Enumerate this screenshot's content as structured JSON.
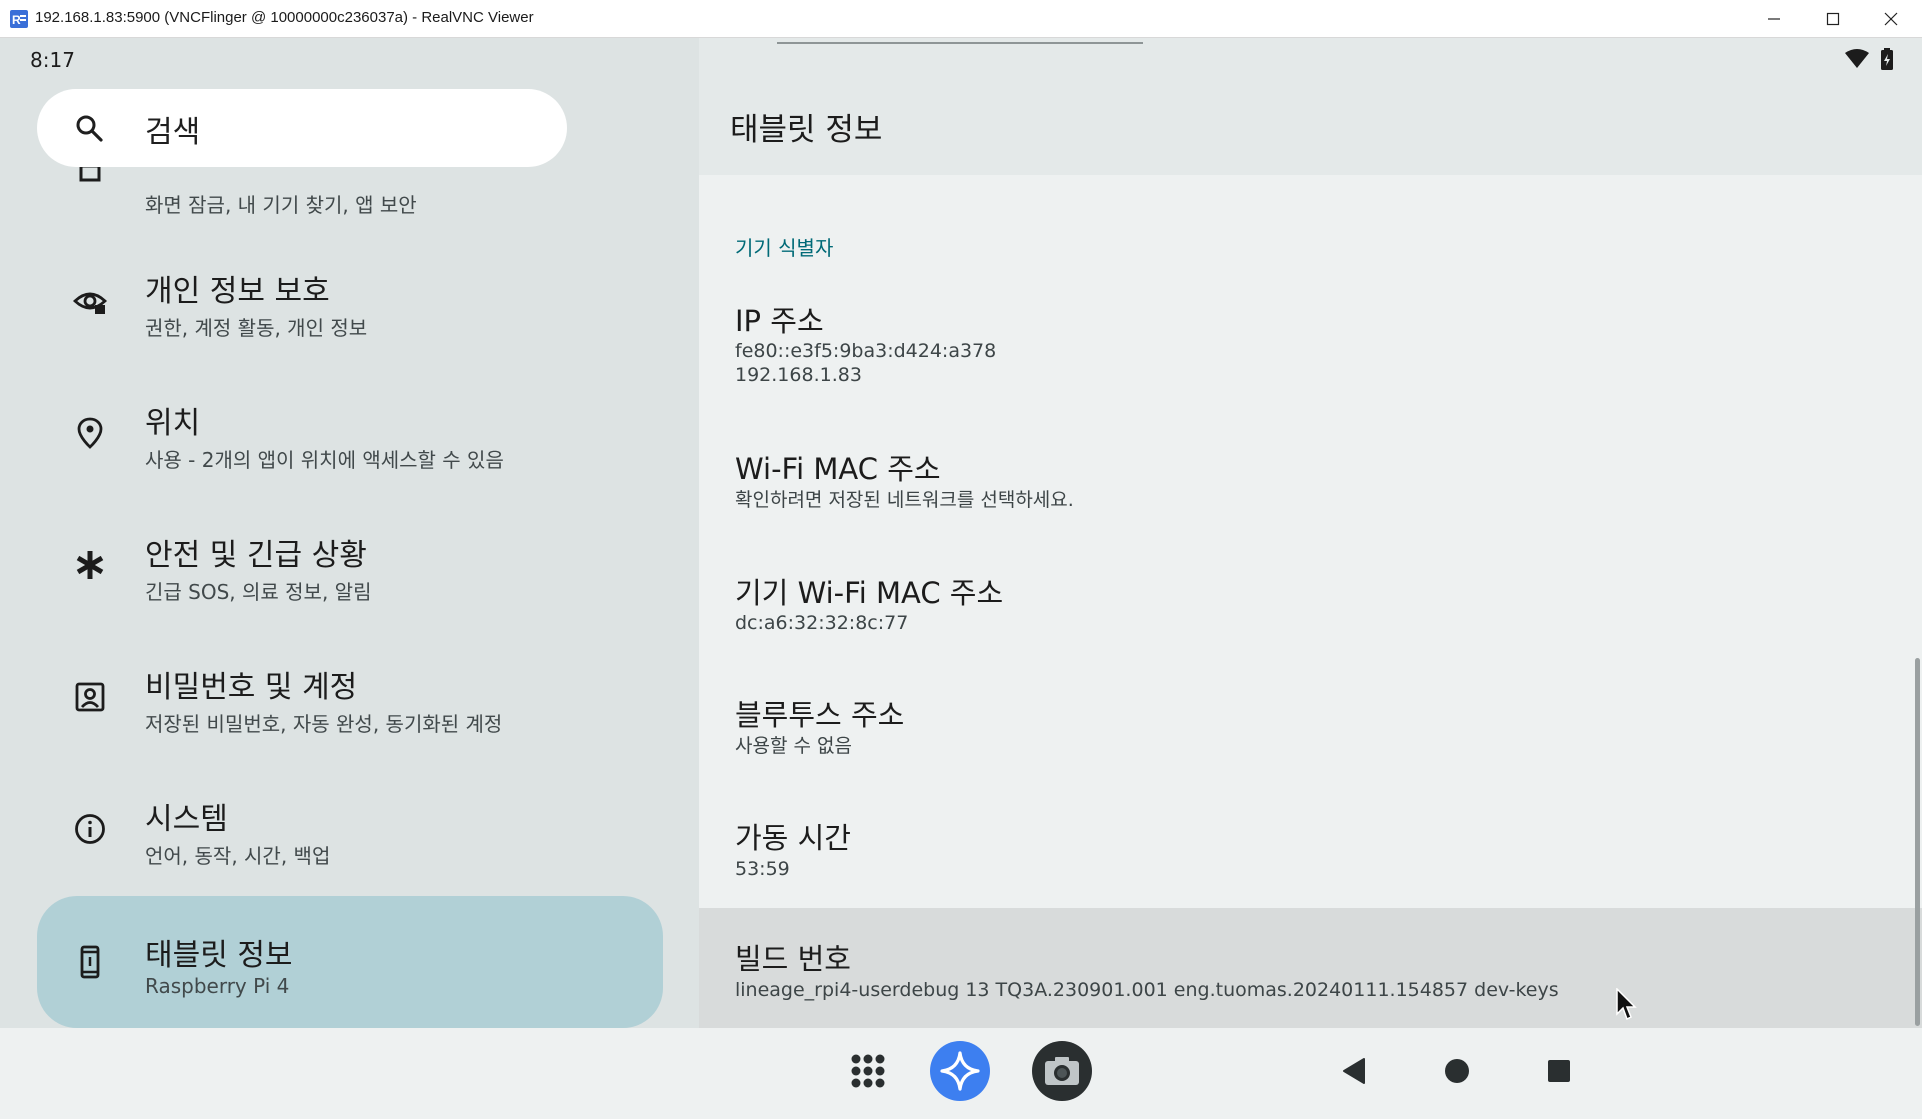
{
  "window": {
    "title": "192.168.1.83:5900 (VNCFlinger @ 10000000c236037a) - RealVNC Viewer",
    "icon": "realvnc-icon"
  },
  "status_bar": {
    "time": "8:17",
    "icons": [
      "wifi-icon",
      "battery-icon"
    ]
  },
  "search": {
    "placeholder": "검색"
  },
  "sidebar": {
    "items": [
      {
        "title": "",
        "subtitle": "화면 잠금, 내 기기 찾기, 앱 보안",
        "icon": "security-icon"
      },
      {
        "title": "개인 정보 보호",
        "subtitle": "권한, 계정 활동, 개인 정보",
        "icon": "privacy-eye-icon"
      },
      {
        "title": "위치",
        "subtitle": "사용 - 2개의 앱이 위치에 액세스할 수 있음",
        "icon": "location-pin-icon"
      },
      {
        "title": "안전 및 긴급 상황",
        "subtitle": "긴급 SOS, 의료 정보, 알림",
        "icon": "emergency-asterisk-icon"
      },
      {
        "title": "비밀번호 및 계정",
        "subtitle": "저장된 비밀번호, 자동 완성, 동기화된 계정",
        "icon": "account-box-icon"
      },
      {
        "title": "시스템",
        "subtitle": "언어, 동작, 시간, 백업",
        "icon": "info-icon"
      },
      {
        "title": "태블릿 정보",
        "subtitle": "Raspberry Pi 4",
        "icon": "tablet-icon",
        "selected": true
      }
    ]
  },
  "detail": {
    "title": "태블릿 정보",
    "section_label": "기기 식별자",
    "prefs": [
      {
        "title": "IP 주소",
        "summary": "fe80::e3f5:9ba3:d424:a378\n192.168.1.83"
      },
      {
        "title": "Wi-Fi MAC 주소",
        "summary": "확인하려면 저장된 네트워크를 선택하세요."
      },
      {
        "title": "기기 Wi-Fi MAC 주소",
        "summary": "dc:a6:32:32:8c:77"
      },
      {
        "title": "블루투스 주소",
        "summary": "사용할 수 없음"
      },
      {
        "title": "가동 시간",
        "summary": "53:59"
      },
      {
        "title": "빌드 번호",
        "summary": "lineage_rpi4-userdebug 13 TQ3A.230901.001 eng.tuomas.20240111.154857 dev-keys"
      }
    ]
  },
  "navbar": {
    "buttons": [
      "app-grid-icon",
      "assistant-sparkle-icon",
      "camera-icon",
      "back-triangle-icon",
      "home-circle-icon",
      "recents-square-icon"
    ]
  },
  "colors": {
    "accent": "#006a77",
    "selected_item": "#b1d0d6",
    "assistant_blue": "#3d7ff0"
  }
}
